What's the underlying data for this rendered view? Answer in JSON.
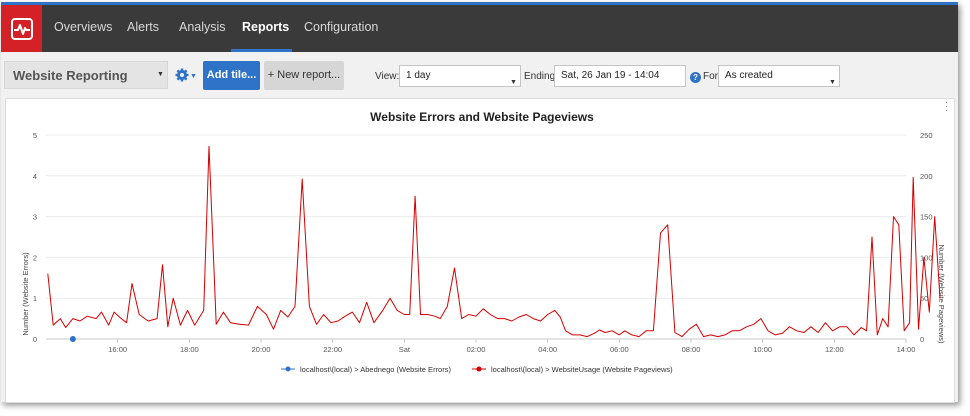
{
  "nav": {
    "items": [
      {
        "label": "Overviews"
      },
      {
        "label": "Alerts"
      },
      {
        "label": "Analysis"
      },
      {
        "label": "Reports"
      },
      {
        "label": "Configuration"
      }
    ],
    "active": "Reports"
  },
  "toolbar": {
    "report_title": "Website Reporting",
    "add_tile_label": "Add tile...",
    "new_report_label": "+ New report...",
    "view_label": "View:",
    "view_value": "1 day",
    "ending_label": "Ending:",
    "ending_value": "Sat, 26 Jan 19 - 14:04",
    "for_label": "For:",
    "for_value": "As created"
  },
  "colors": {
    "accent": "#2f73c8",
    "brand": "#d42027",
    "series_errors": "#2f73c8",
    "series_pageviews": "#d40000"
  },
  "chart_data": {
    "type": "line",
    "title": "Website Errors and Website Pageviews",
    "ylabel_left": "Number (Website Errors)",
    "ylabel_right": "Number (Website Pageviews)",
    "ylim_left": [
      0,
      5
    ],
    "ylim_right": [
      0,
      250
    ],
    "yticks_left": [
      "0",
      "1",
      "2",
      "3",
      "4",
      "5"
    ],
    "yticks_right": [
      "0",
      "50",
      "100",
      "150",
      "200",
      "250"
    ],
    "xlim_hours": [
      14.0,
      38.0
    ],
    "xticks": [
      {
        "hour": 16,
        "label": "16:00"
      },
      {
        "hour": 18,
        "label": "18:00"
      },
      {
        "hour": 20,
        "label": "20:00"
      },
      {
        "hour": 22,
        "label": "22:00"
      },
      {
        "hour": 24,
        "label": "Sat"
      },
      {
        "hour": 26,
        "label": "02:00"
      },
      {
        "hour": 28,
        "label": "04:00"
      },
      {
        "hour": 30,
        "label": "06:00"
      },
      {
        "hour": 32,
        "label": "08:00"
      },
      {
        "hour": 34,
        "label": "10:00"
      },
      {
        "hour": 36,
        "label": "12:00"
      },
      {
        "hour": 38,
        "label": "14:00"
      }
    ],
    "grid": true,
    "legend_position": "bottom",
    "series": [
      {
        "name": "localhost\\(local) > Abednego (Website Errors)",
        "axis": "left",
        "marker": "point",
        "points": [
          [
            14.75,
            0
          ]
        ]
      },
      {
        "name": "localhost\\(local) > WebsiteUsage (Website Pageviews)",
        "axis": "right",
        "marker": "line",
        "points": [
          [
            14.05,
            80
          ],
          [
            14.2,
            17
          ],
          [
            14.4,
            25
          ],
          [
            14.55,
            14
          ],
          [
            14.75,
            25
          ],
          [
            14.95,
            22
          ],
          [
            15.15,
            28
          ],
          [
            15.4,
            25
          ],
          [
            15.55,
            33
          ],
          [
            15.75,
            17
          ],
          [
            15.9,
            33
          ],
          [
            16.1,
            25
          ],
          [
            16.25,
            20
          ],
          [
            16.4,
            68
          ],
          [
            16.6,
            30
          ],
          [
            16.85,
            22
          ],
          [
            17.1,
            25
          ],
          [
            17.25,
            91
          ],
          [
            17.4,
            15
          ],
          [
            17.55,
            50
          ],
          [
            17.75,
            17
          ],
          [
            17.95,
            35
          ],
          [
            18.15,
            17
          ],
          [
            18.4,
            35
          ],
          [
            18.55,
            236
          ],
          [
            18.75,
            18
          ],
          [
            18.95,
            33
          ],
          [
            19.15,
            20
          ],
          [
            19.4,
            18
          ],
          [
            19.65,
            17
          ],
          [
            19.9,
            40
          ],
          [
            20.15,
            30
          ],
          [
            20.35,
            12
          ],
          [
            20.55,
            35
          ],
          [
            20.75,
            27
          ],
          [
            20.95,
            40
          ],
          [
            21.15,
            196
          ],
          [
            21.35,
            40
          ],
          [
            21.55,
            18
          ],
          [
            21.75,
            30
          ],
          [
            21.95,
            20
          ],
          [
            22.15,
            22
          ],
          [
            22.35,
            28
          ],
          [
            22.55,
            33
          ],
          [
            22.75,
            20
          ],
          [
            22.95,
            45
          ],
          [
            23.15,
            20
          ],
          [
            23.4,
            35
          ],
          [
            23.6,
            50
          ],
          [
            23.8,
            35
          ],
          [
            24.0,
            30
          ],
          [
            24.15,
            30
          ],
          [
            24.3,
            175
          ],
          [
            24.45,
            30
          ],
          [
            24.65,
            30
          ],
          [
            24.85,
            28
          ],
          [
            25.0,
            25
          ],
          [
            25.2,
            40
          ],
          [
            25.4,
            87
          ],
          [
            25.6,
            25
          ],
          [
            25.8,
            30
          ],
          [
            26.0,
            28
          ],
          [
            26.2,
            37
          ],
          [
            26.4,
            30
          ],
          [
            26.6,
            25
          ],
          [
            26.8,
            25
          ],
          [
            27.0,
            22
          ],
          [
            27.2,
            27
          ],
          [
            27.4,
            30
          ],
          [
            27.6,
            25
          ],
          [
            27.8,
            22
          ],
          [
            28.0,
            30
          ],
          [
            28.2,
            35
          ],
          [
            28.35,
            27
          ],
          [
            28.5,
            10
          ],
          [
            28.7,
            5
          ],
          [
            28.9,
            5
          ],
          [
            29.1,
            3
          ],
          [
            29.3,
            7
          ],
          [
            29.45,
            11
          ],
          [
            29.6,
            8
          ],
          [
            29.8,
            10
          ],
          [
            30.0,
            5
          ],
          [
            30.15,
            10
          ],
          [
            30.35,
            5
          ],
          [
            30.55,
            3
          ],
          [
            30.75,
            10
          ],
          [
            30.95,
            10
          ],
          [
            31.15,
            130
          ],
          [
            31.35,
            140
          ],
          [
            31.55,
            8
          ],
          [
            31.75,
            3
          ],
          [
            31.95,
            12
          ],
          [
            32.15,
            18
          ],
          [
            32.35,
            3
          ],
          [
            32.55,
            5
          ],
          [
            32.75,
            3
          ],
          [
            32.95,
            5
          ],
          [
            33.15,
            10
          ],
          [
            33.35,
            10
          ],
          [
            33.55,
            15
          ],
          [
            33.75,
            18
          ],
          [
            33.95,
            25
          ],
          [
            34.15,
            10
          ],
          [
            34.35,
            5
          ],
          [
            34.55,
            7
          ],
          [
            34.75,
            15
          ],
          [
            34.95,
            10
          ],
          [
            35.15,
            8
          ],
          [
            35.35,
            15
          ],
          [
            35.55,
            8
          ],
          [
            35.75,
            20
          ],
          [
            35.95,
            10
          ],
          [
            36.15,
            15
          ],
          [
            36.35,
            15
          ],
          [
            36.55,
            5
          ],
          [
            36.75,
            14
          ],
          [
            36.9,
            10
          ],
          [
            37.05,
            125
          ],
          [
            37.2,
            5
          ],
          [
            37.35,
            25
          ],
          [
            37.5,
            15
          ],
          [
            37.65,
            150
          ],
          [
            37.8,
            140
          ],
          [
            37.95,
            10
          ],
          [
            38.1,
            20
          ],
          [
            38.2,
            198
          ],
          [
            38.35,
            12
          ],
          [
            38.5,
            100
          ],
          [
            38.65,
            33
          ],
          [
            38.8,
            150
          ],
          [
            38.95,
            50
          ]
        ]
      }
    ]
  }
}
